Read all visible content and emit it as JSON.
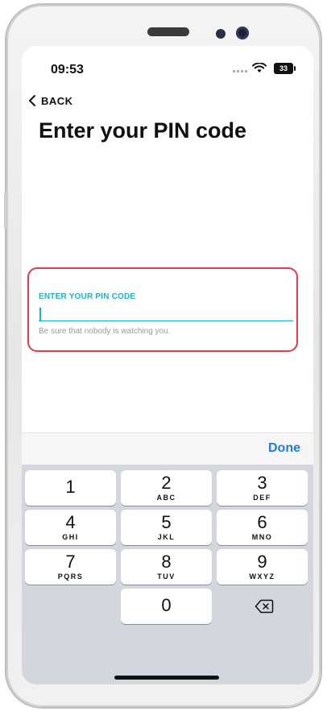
{
  "status_bar": {
    "time": "09:53",
    "battery": "33"
  },
  "header": {
    "back_label": "BACK",
    "title": "Enter your PIN code"
  },
  "pin_field": {
    "label": "ENTER YOUR PIN CODE",
    "value": "",
    "hint": "Be sure that nobody is watching you."
  },
  "keyboard": {
    "done_label": "Done",
    "keys": [
      {
        "num": "1",
        "letters": ""
      },
      {
        "num": "2",
        "letters": "ABC"
      },
      {
        "num": "3",
        "letters": "DEF"
      },
      {
        "num": "4",
        "letters": "GHI"
      },
      {
        "num": "5",
        "letters": "JKL"
      },
      {
        "num": "6",
        "letters": "MNO"
      },
      {
        "num": "7",
        "letters": "PQRS"
      },
      {
        "num": "8",
        "letters": "TUV"
      },
      {
        "num": "9",
        "letters": "WXYZ"
      },
      {
        "num": "0",
        "letters": ""
      }
    ]
  },
  "colors": {
    "accent": "#1bb3c9",
    "highlight_border": "#e23b49",
    "done": "#1f7be0"
  }
}
